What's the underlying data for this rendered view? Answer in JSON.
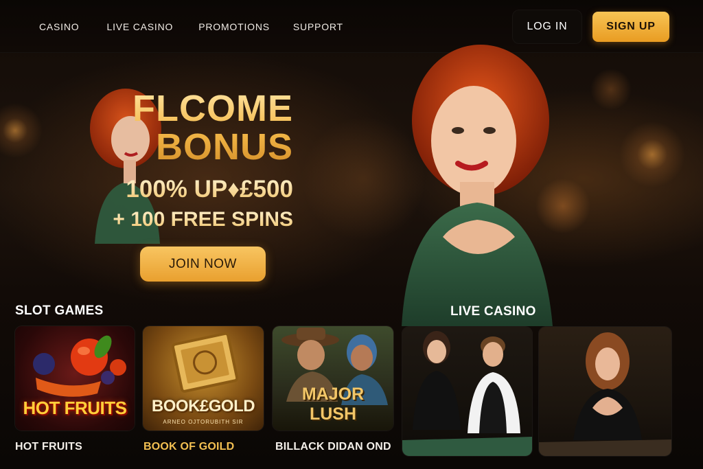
{
  "header": {
    "nav": [
      "CASINO",
      "LIVE CASINO",
      "PROMOTIONS",
      "SUPPORT"
    ],
    "login_label": "LOG IN",
    "signup_label": "SIGN UP"
  },
  "hero": {
    "title_line1": "FLCOME",
    "title_line2": "BONUS",
    "offer_line1": "100% UP♦£500",
    "offer_line2": "+ 100 FREE SPINS",
    "cta_label": "JOIN NOW"
  },
  "sections": {
    "slots_title": "SLOT GAMES",
    "live_title": "LIVE CASINO"
  },
  "slot_games": [
    {
      "tile_text": "HOT FRUITS",
      "name": "HOT FRUITS"
    },
    {
      "tile_text": "BOOK£GOLD",
      "tile_subtext": "ARNEO OJTORUBITH SIR",
      "name": "BOOK OF GOILD"
    },
    {
      "tile_text_line1": "MAJOR",
      "tile_text_line2": "LUSH",
      "name": "BILLACK DIDAN OND"
    }
  ],
  "colors": {
    "accent_gold": "#f0a830",
    "background": "#0b0705",
    "highlight_text": "#f3c052"
  },
  "icons": [
    "gem-icon"
  ]
}
